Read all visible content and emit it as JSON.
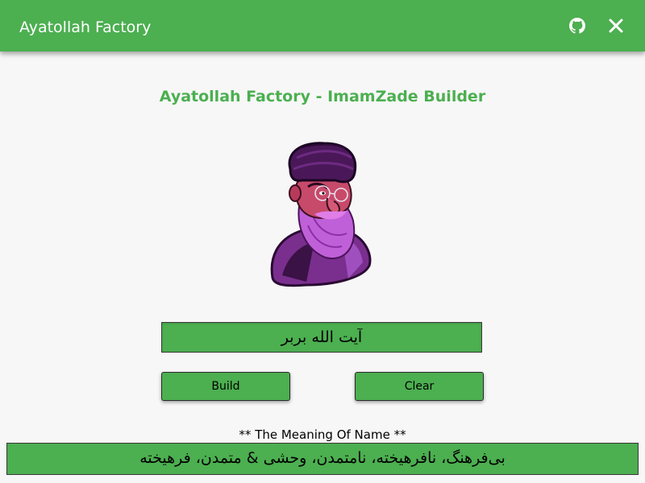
{
  "appbar": {
    "title": "Ayatollah Factory",
    "github_icon": "github-icon",
    "close_icon": "close-icon",
    "color": "#4caf50"
  },
  "main": {
    "heading": "Ayatollah Factory - ImamZade Builder",
    "portrait_icon": "ayatollah-portrait",
    "name_value": "آیت الله بربر",
    "build_label": "Build",
    "clear_label": "Clear",
    "meaning_title": "** The Meaning Of Name **",
    "meaning_text": "بی‌فرهنگ، نافرهیخته، نامتمدن، وحشی & متمدن، فرهیخته"
  },
  "colors": {
    "accent": "#4caf50",
    "background": "#f7f7f7",
    "portrait_purple": "#a040c0"
  }
}
